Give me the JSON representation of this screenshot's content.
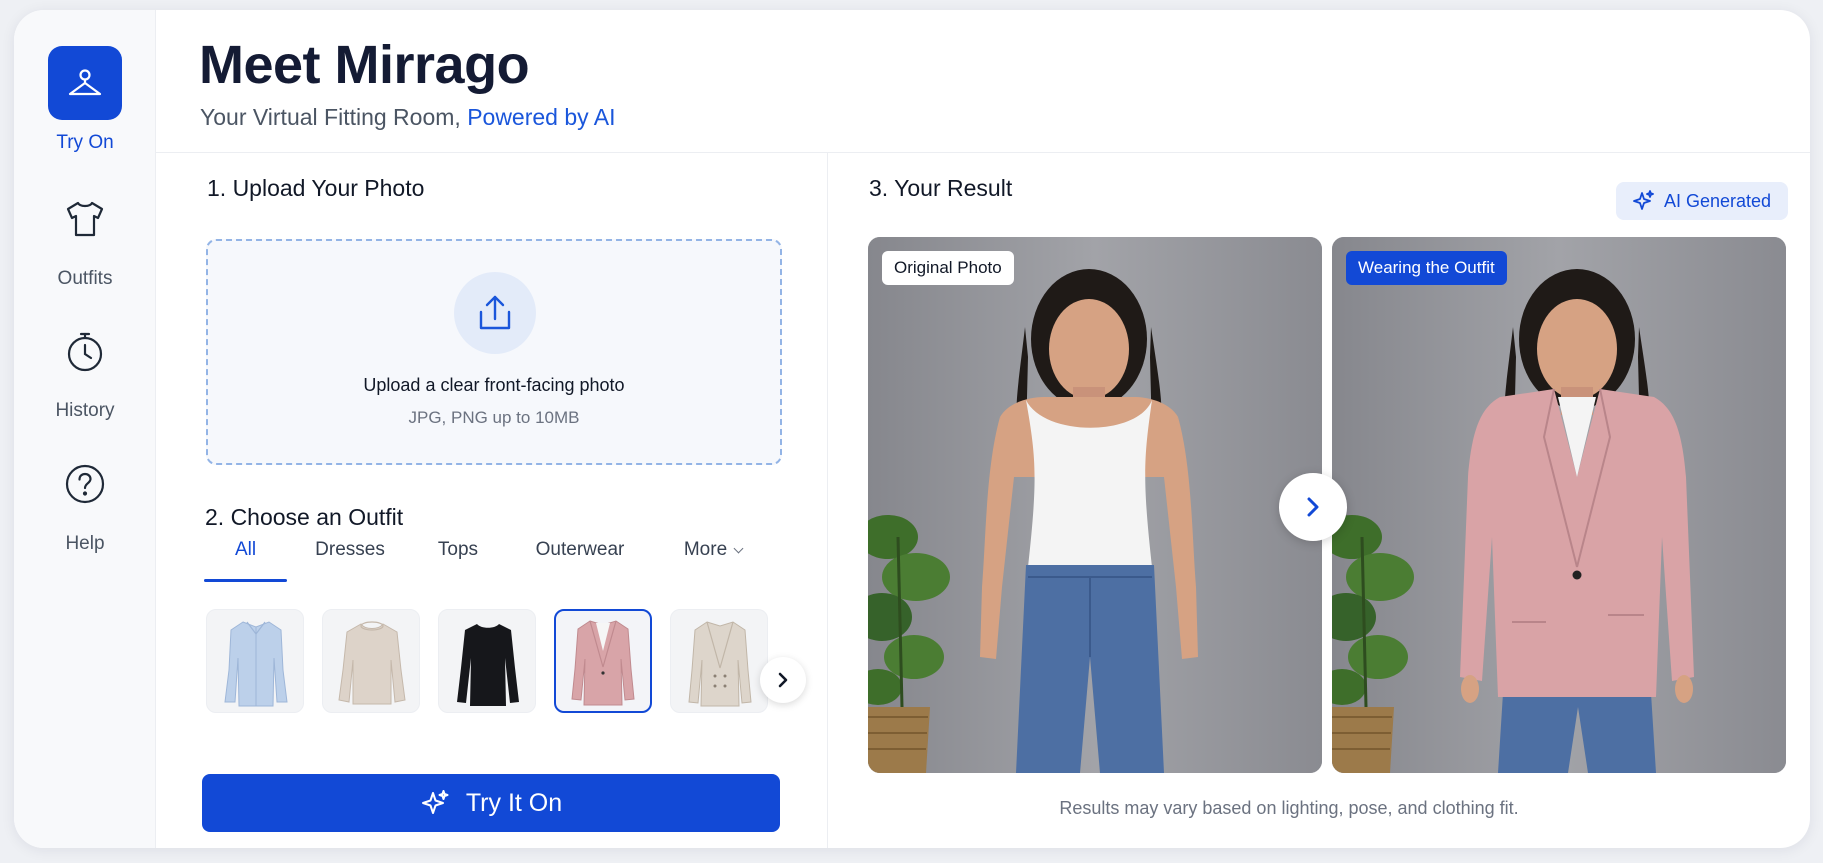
{
  "sidebar": {
    "items": [
      {
        "label": "Try On",
        "icon": "hanger-icon",
        "active": true
      },
      {
        "label": "Outfits",
        "icon": "tshirt-icon",
        "active": false
      },
      {
        "label": "History",
        "icon": "stopwatch-icon",
        "active": false
      },
      {
        "label": "Help",
        "icon": "help-circle-icon",
        "active": false
      }
    ]
  },
  "header": {
    "title": "Meet Mirrago",
    "subtitle": "Your Virtual Fitting Room, ",
    "subtitle_accent": "Powered by AI"
  },
  "upload": {
    "section_title": "1. Upload Your Photo",
    "main_text": "Upload a clear front-facing photo",
    "sub_text": "JPG, PNG up to 10MB",
    "icon": "upload-icon"
  },
  "outfit_picker": {
    "section_title": "2. Choose an Outfit",
    "tabs": [
      {
        "label": "All",
        "active": true
      },
      {
        "label": "Dresses",
        "active": false
      },
      {
        "label": "Tops",
        "active": false
      },
      {
        "label": "Outerwear",
        "active": false
      },
      {
        "label": "More",
        "active": false
      }
    ],
    "items": [
      {
        "name": "light blue button-up shirt",
        "color": "#bcd0ea",
        "selected": false
      },
      {
        "name": "beige knit sweater",
        "color": "#ddd3c9",
        "selected": false
      },
      {
        "name": "black long-sleeve top",
        "color": "#16171b",
        "selected": false
      },
      {
        "name": "pink blazer",
        "color": "#d8a4a8",
        "selected": true
      },
      {
        "name": "cream double-breasted blazer",
        "color": "#ddd5cb",
        "selected": false
      }
    ]
  },
  "try_button": {
    "label": "Try It On",
    "icon": "sparkle-icon"
  },
  "result": {
    "section_title": "3. Your Result",
    "badge": "AI Generated",
    "original_label": "Original Photo",
    "outfit_label": "Wearing the Outfit",
    "disclaimer": "Results may vary based on lighting, pose, and clothing fit."
  },
  "colors": {
    "accent": "#1249d6",
    "accent_text": "#1a56db",
    "photo_background": "#8f9097"
  }
}
